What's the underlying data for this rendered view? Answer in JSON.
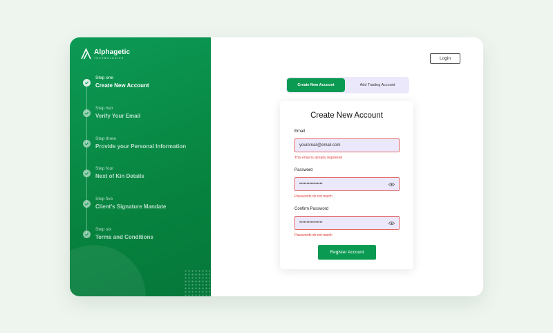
{
  "brand": {
    "name": "Alphagetic",
    "tagline": "TECHNOLOGIES"
  },
  "colors": {
    "accent": "#0b9a52",
    "error": "#e23a3a",
    "field_bg": "#ece8fb"
  },
  "steps": [
    {
      "num": "Step one",
      "title": "Create New Account",
      "active": true
    },
    {
      "num": "Step two",
      "title": "Verify Your Email",
      "active": false
    },
    {
      "num": "Step three",
      "title": "Provide your Personal Information",
      "active": false
    },
    {
      "num": "Step four",
      "title": "Next of Kin Details",
      "active": false
    },
    {
      "num": "Step five",
      "title": "Client's Signature Mandate",
      "active": false
    },
    {
      "num": "Step six",
      "title": "Terms and Conditions",
      "active": false
    }
  ],
  "header": {
    "login_label": "Login"
  },
  "tabs": [
    {
      "label": "Create New Account",
      "active": true
    },
    {
      "label": "Add Trading Account",
      "active": false
    }
  ],
  "form": {
    "title": "Create New Account",
    "email": {
      "label": "Email",
      "value": "youremail@email.com",
      "error": "This email is already registered"
    },
    "password": {
      "label": "Password",
      "value": "••••••••••••••••",
      "error": "Passwords do not match",
      "icon": "eye-icon"
    },
    "confirm_password": {
      "label": "Confirm Password",
      "value": "••••••••••••••••",
      "error": "Passwords do not match",
      "icon": "eye-icon"
    },
    "submit_label": "Register Account"
  }
}
